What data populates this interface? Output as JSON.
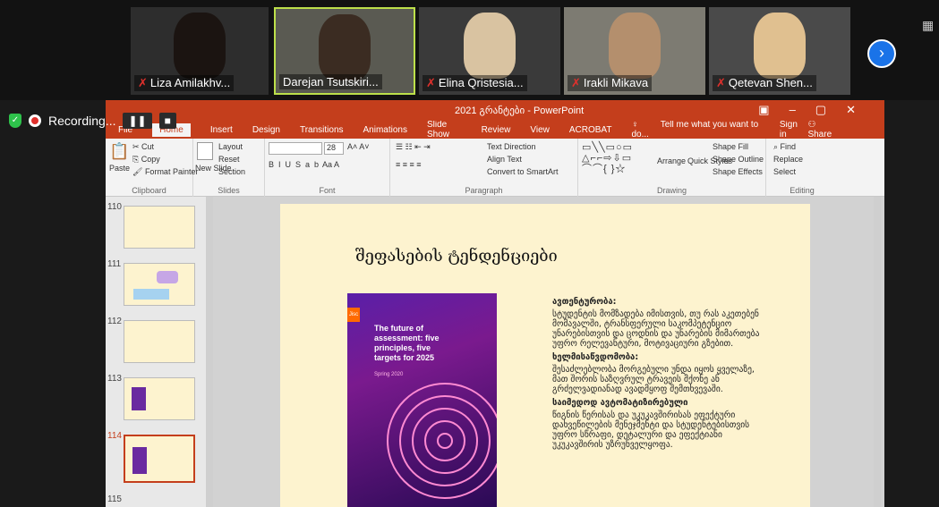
{
  "participants": [
    {
      "name": "Liza Amilakhv...",
      "muted": true
    },
    {
      "name": "Darejan Tsutskiri...",
      "muted": false
    },
    {
      "name": "Elina Qristesia...",
      "muted": true
    },
    {
      "name": "Irakli Mikava",
      "muted": true
    },
    {
      "name": "Qetevan Shen...",
      "muted": true
    }
  ],
  "recording": {
    "label": "Recording...",
    "pause": "❚❚",
    "stop": "■"
  },
  "ppt": {
    "window_title": "2021 გრანტები - PowerPoint",
    "tabs": [
      "File",
      "Home",
      "Insert",
      "Design",
      "Transitions",
      "Animations",
      "Slide Show",
      "Review",
      "View",
      "ACROBAT"
    ],
    "tell_me": "Tell me what you want to do...",
    "sign_in": "Sign in",
    "share": "Share",
    "ribbon": {
      "clipboard": {
        "label": "Clipboard",
        "paste": "Paste",
        "cut": "Cut",
        "copy": "Copy",
        "format_painter": "Format Painter"
      },
      "slides": {
        "label": "Slides",
        "new_slide": "New Slide",
        "layout": "Layout",
        "reset": "Reset",
        "section": "Section"
      },
      "font": {
        "label": "Font",
        "size": "28"
      },
      "paragraph": {
        "label": "Paragraph",
        "text_direction": "Text Direction",
        "align_text": "Align Text",
        "smartart": "Convert to SmartArt"
      },
      "drawing": {
        "label": "Drawing",
        "arrange": "Arrange",
        "quick_styles": "Quick Styles",
        "shape_fill": "Shape Fill",
        "shape_outline": "Shape Outline",
        "shape_effects": "Shape Effects"
      },
      "editing": {
        "label": "Editing",
        "find": "Find",
        "replace": "Replace",
        "select": "Select"
      }
    },
    "thumbnails": [
      "110",
      "111",
      "112",
      "113",
      "114",
      "115"
    ],
    "selected_slide": "114",
    "slide": {
      "title": "შეფასების ტენდენციები",
      "cover": {
        "logo": "Jisc",
        "title": "The future of assessment: five principles, five targets for 2025",
        "date": "Spring 2020"
      },
      "sections": [
        {
          "heading": "ავთენტურობა:",
          "body": "სტუდენტის მომზადება იმისთვის, თუ რას აკეთებენ მომავალში, ტრანსფერული საკომპეტენციო უნარებისთვის და ცოდნის და უნარების მიმართება უფრო რელევანტური, მოტივაციური გზებით."
        },
        {
          "heading": "ხელმისაწვდომობა:",
          "body": "შესაძლებლობა მორგებული უნდა იყოს ყველაზე, მათ შორის საზღვრულ ტრავეის მქონე ან გრძელვადიანად ავადმყოფ შემთხვევაში."
        },
        {
          "heading": "საიმედოდ ავტომატიზირებული",
          "body": "წიგნის წერისას და უკუკავშირისას ეფექტური დახვეწილების მენეჯმენტი და სტუდენტებისთვის უფრო სწრაფი, დეტალური და ეფექტიანი უკუკავშირის უზრუნველყოფა."
        }
      ]
    }
  }
}
